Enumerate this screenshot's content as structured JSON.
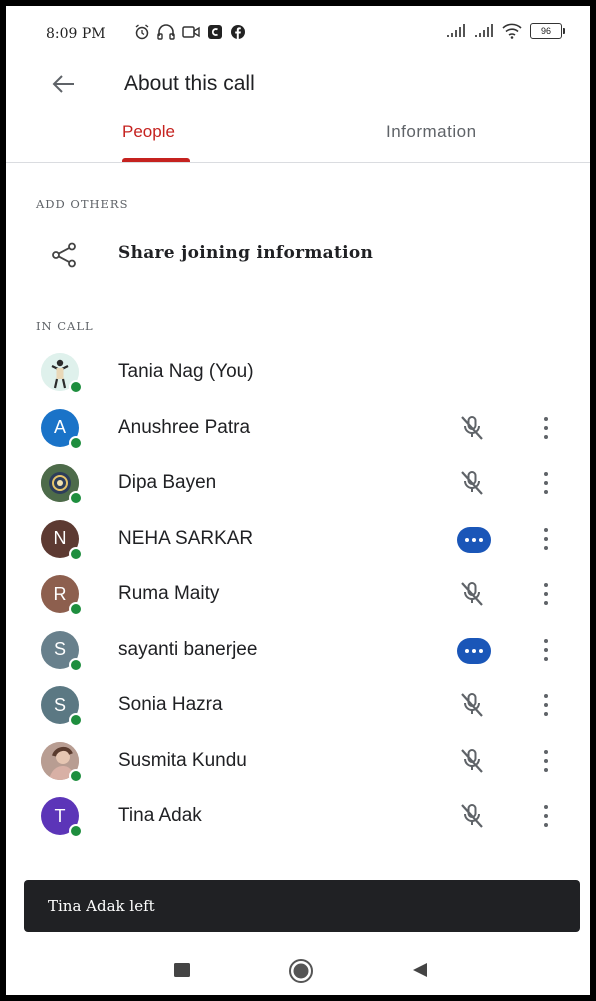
{
  "status_bar": {
    "time": "8:09 PM",
    "battery": "96",
    "left_icons": [
      "alarm-icon",
      "headphones-icon",
      "video-icon",
      "app-icon",
      "facebook-icon"
    ],
    "right_icons": [
      "signal-icon",
      "signal-icon",
      "wifi-icon",
      "battery-icon"
    ]
  },
  "header": {
    "title": "About this call",
    "back_icon": "arrow-left-icon"
  },
  "tabs": [
    {
      "label": "People",
      "selected": true
    },
    {
      "label": "Information",
      "selected": false
    }
  ],
  "add_others": {
    "heading": "ADD OTHERS",
    "share_label": "Share joining information",
    "share_icon": "share-icon"
  },
  "in_call": {
    "heading": "IN CALL",
    "participants": [
      {
        "name": "Tania Nag (You)",
        "initial": "",
        "avatar": "photo",
        "status": "none",
        "color": "#e8f3ef"
      },
      {
        "name": "Anushree Patra",
        "initial": "A",
        "avatar": "initial",
        "status": "muted",
        "color": "#1a73c8"
      },
      {
        "name": "Dipa Bayen",
        "initial": "",
        "avatar": "photo",
        "status": "muted",
        "color": "#6b7a5a"
      },
      {
        "name": "NEHA SARKAR",
        "initial": "N",
        "avatar": "initial",
        "status": "talking",
        "color": "#5d3a32"
      },
      {
        "name": "Ruma Maity",
        "initial": "R",
        "avatar": "initial",
        "status": "muted",
        "color": "#8d5f4e"
      },
      {
        "name": "sayanti banerjee",
        "initial": "S",
        "avatar": "initial",
        "status": "talking",
        "color": "#68808c"
      },
      {
        "name": "Sonia Hazra",
        "initial": "S",
        "avatar": "initial",
        "status": "muted",
        "color": "#5b7883"
      },
      {
        "name": "Susmita Kundu",
        "initial": "",
        "avatar": "photo",
        "status": "muted",
        "color": "#c7a59a"
      },
      {
        "name": "Tina Adak",
        "initial": "T",
        "avatar": "initial",
        "status": "muted",
        "color": "#5c35b8"
      }
    ]
  },
  "snackbar": {
    "text": "Tina Adak left"
  },
  "nav": {
    "icons": [
      "recents-square-icon",
      "home-circle-icon",
      "back-triangle-icon"
    ]
  },
  "colors": {
    "accent": "#c5221f",
    "online": "#1e8e3e",
    "talking": "#1a56b8"
  }
}
